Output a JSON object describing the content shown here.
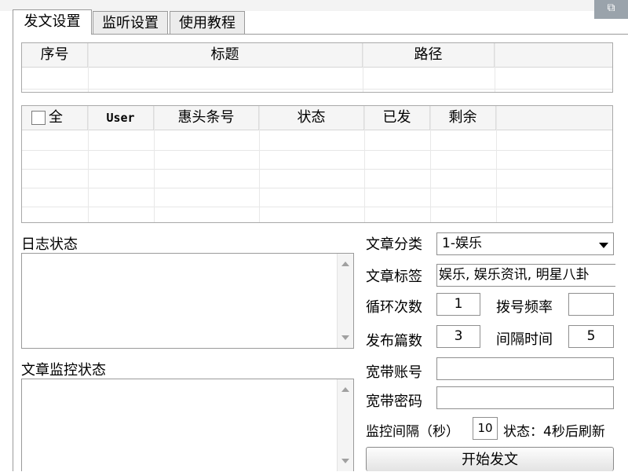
{
  "tabs": [
    {
      "label": "发文设置",
      "active": true
    },
    {
      "label": "监听设置",
      "active": false
    },
    {
      "label": "使用教程",
      "active": false
    }
  ],
  "corner_icon": "restore-icon",
  "grid1": {
    "headers": [
      "序号",
      "标题",
      "路径",
      ""
    ],
    "rows": 1
  },
  "grid2": {
    "select_all_label": "全",
    "headers": [
      "User",
      "惠头条号",
      "状态",
      "已发",
      "剩余",
      ""
    ],
    "rows": 4
  },
  "log": {
    "label": "日志状态"
  },
  "monitor": {
    "label": "文章监控状态"
  },
  "form": {
    "category_label": "文章分类",
    "category_value": "1-娱乐",
    "tags_label": "文章标签",
    "tags_value": "娱乐, 娱乐资讯, 明星八卦",
    "loop_label": "循环次数",
    "loop_value": "1",
    "dial_label": "拨号频率",
    "dial_value": "",
    "post_count_label": "发布篇数",
    "post_count_value": "3",
    "interval_label": "间隔时间",
    "interval_value": "5",
    "broadband_account_label": "宽带账号",
    "broadband_account_value": "",
    "broadband_password_label": "宽带密码",
    "broadband_password_value": "",
    "monitor_interval_label": "监控间隔（秒）",
    "monitor_interval_value": "10",
    "status_text": "状态：4秒后刷新",
    "start_button": "开始发文"
  }
}
